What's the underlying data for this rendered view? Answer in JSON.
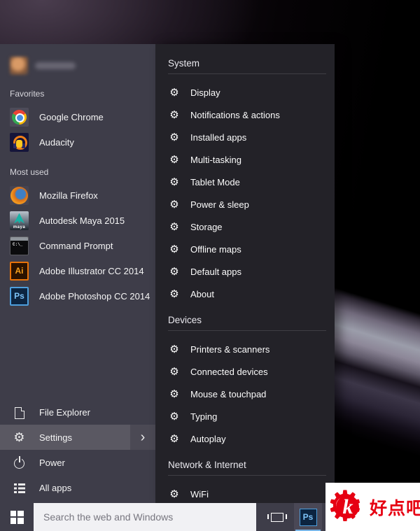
{
  "colors": {
    "start_menu_bg": "#3e3d49",
    "selected_row_bg": "#5a5862",
    "flyout_bg": "#232228",
    "divider": "#3f3e44",
    "taskbar_bg": "#3e3d49",
    "search_bg": "#f1f1f4",
    "watermark_red": "#e60012",
    "photoshop_blue": "#31a8ff"
  },
  "icons": {
    "gear_glyph": "⚙",
    "chevron_right": "›"
  },
  "start_menu": {
    "sections": [
      {
        "label": "Favorites",
        "apps": [
          {
            "name": "Google Chrome",
            "icon": "chrome"
          },
          {
            "name": "Audacity",
            "icon": "audacity"
          }
        ]
      },
      {
        "label": "Most used",
        "apps": [
          {
            "name": "Mozilla Firefox",
            "icon": "firefox"
          },
          {
            "name": "Autodesk Maya 2015",
            "icon": "maya",
            "icon_text": "maya"
          },
          {
            "name": "Command Prompt",
            "icon": "cmd",
            "icon_text": "C:\\_"
          },
          {
            "name": "Adobe Illustrator CC 2014",
            "icon": "ai",
            "icon_text": "Ai"
          },
          {
            "name": "Adobe Photoshop CC 2014",
            "icon": "ps",
            "icon_text": "Ps"
          }
        ]
      }
    ],
    "bottom_items": [
      {
        "label": "File Explorer",
        "icon": "file-explorer",
        "selected": false
      },
      {
        "label": "Settings",
        "icon": "settings",
        "selected": true
      },
      {
        "label": "Power",
        "icon": "power",
        "selected": false
      },
      {
        "label": "All apps",
        "icon": "all-apps",
        "selected": false
      }
    ]
  },
  "settings_flyout": {
    "groups": [
      {
        "header": "System",
        "items": [
          "Display",
          "Notifications & actions",
          "Installed apps",
          "Multi-tasking",
          "Tablet Mode",
          "Power & sleep",
          "Storage",
          "Offline maps",
          "Default apps",
          "About"
        ]
      },
      {
        "header": "Devices",
        "items": [
          "Printers & scanners",
          "Connected devices",
          "Mouse & touchpad",
          "Typing",
          "Autoplay"
        ]
      },
      {
        "header": "Network & Internet",
        "items": [
          "WiFi"
        ]
      }
    ]
  },
  "taskbar": {
    "search_placeholder": "Search the web and Windows",
    "photoshop_label": "Ps"
  },
  "watermark": {
    "text": "好点吧",
    "letter": "k"
  }
}
